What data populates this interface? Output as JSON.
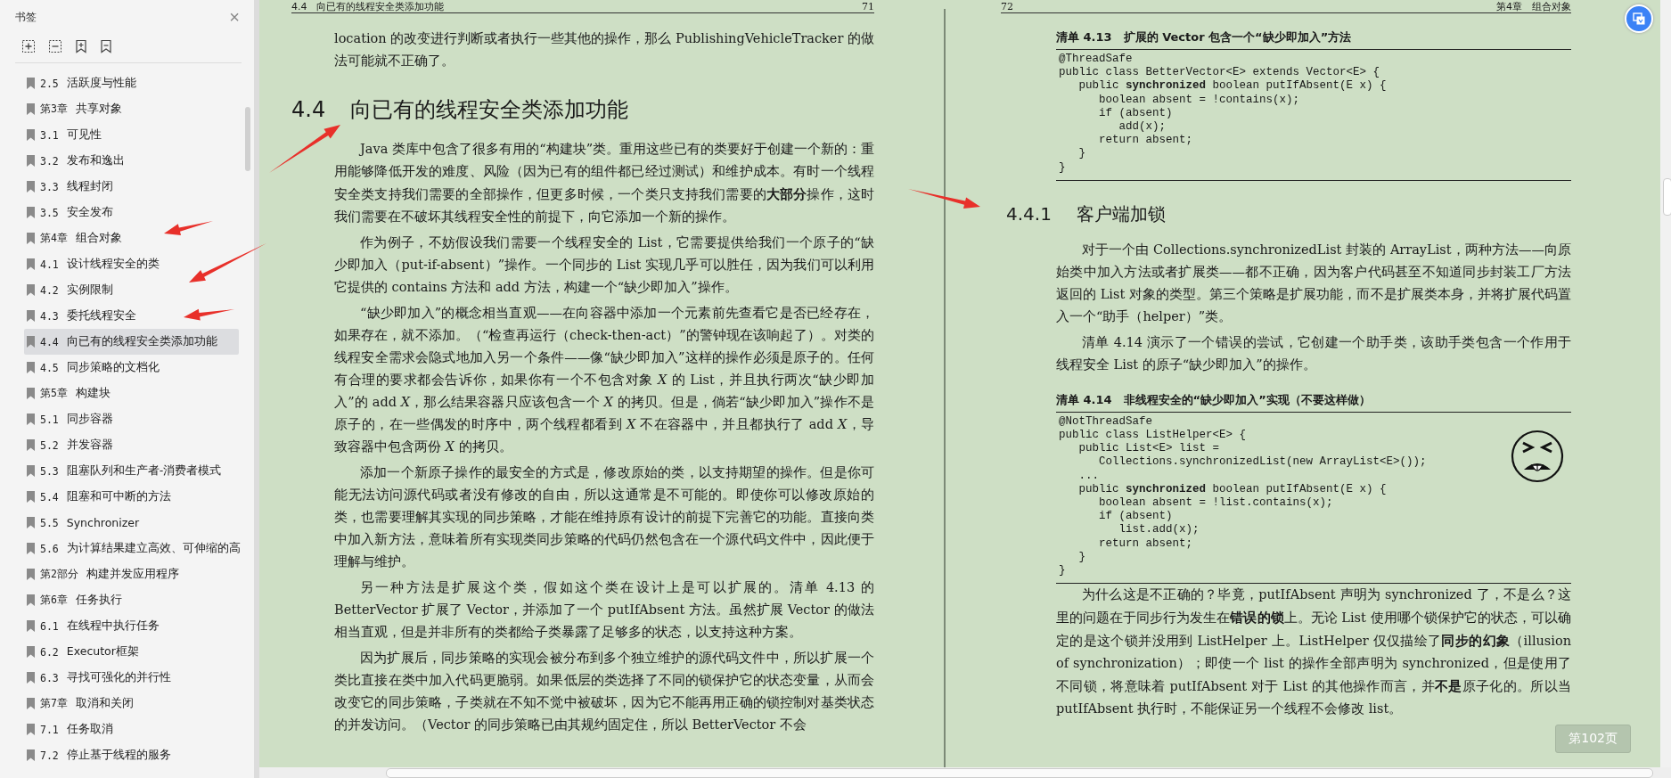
{
  "sidebar": {
    "title": "书签",
    "close": "×",
    "items": [
      {
        "num": "2.5",
        "title": "活跃度与性能",
        "selected": false
      },
      {
        "num": "第3章",
        "title": "共享对象",
        "selected": false
      },
      {
        "num": "3.1",
        "title": "可见性",
        "selected": false
      },
      {
        "num": "3.2",
        "title": "发布和逸出",
        "selected": false
      },
      {
        "num": "3.3",
        "title": "线程封闭",
        "selected": false
      },
      {
        "num": "3.5",
        "title": "安全发布",
        "selected": false
      },
      {
        "num": "第4章",
        "title": "组合对象",
        "selected": false
      },
      {
        "num": "4.1",
        "title": "设计线程安全的类",
        "selected": false
      },
      {
        "num": "4.2",
        "title": "实例限制",
        "selected": false
      },
      {
        "num": "4.3",
        "title": "委托线程安全",
        "selected": false
      },
      {
        "num": "4.4",
        "title": "向已有的线程安全类添加功能",
        "selected": true
      },
      {
        "num": "4.5",
        "title": "同步策略的文档化",
        "selected": false
      },
      {
        "num": "第5章",
        "title": "构建块",
        "selected": false
      },
      {
        "num": "5.1",
        "title": "同步容器",
        "selected": false
      },
      {
        "num": "5.2",
        "title": "并发容器",
        "selected": false
      },
      {
        "num": "5.3",
        "title": "阻塞队列和生产者-消费者模式",
        "selected": false
      },
      {
        "num": "5.4",
        "title": "阻塞和可中断的方法",
        "selected": false
      },
      {
        "num": "5.5",
        "title": "Synchronizer",
        "selected": false
      },
      {
        "num": "5.6",
        "title": "为计算结果建立高效、可伸缩的高",
        "selected": false
      },
      {
        "num": "第2部分",
        "title": "构建并发应用程序",
        "selected": false
      },
      {
        "num": "第6章",
        "title": "任务执行",
        "selected": false
      },
      {
        "num": "6.1",
        "title": "在线程中执行任务",
        "selected": false
      },
      {
        "num": "6.2",
        "title": "Executor框架",
        "selected": false
      },
      {
        "num": "6.3",
        "title": "寻找可强化的并行性",
        "selected": false
      },
      {
        "num": "第7章",
        "title": "取消和关闭",
        "selected": false
      },
      {
        "num": "7.1",
        "title": "任务取消",
        "selected": false
      },
      {
        "num": "7.2",
        "title": "停止基于线程的服务",
        "selected": false
      }
    ]
  },
  "left_page": {
    "header_title": "4.4　向已有的线程安全类添加功能",
    "page_number": "71",
    "blocks": [
      {
        "kind": "para",
        "text": "location 的改变进行判断或者执行一些其他的操作，那么 PublishingVehicleTracker 的做法可能就不正确了。",
        "indent": false
      },
      {
        "kind": "heading",
        "num": "4.4",
        "text": "向已有的线程安全类添加功能"
      },
      {
        "kind": "para",
        "text": "Java 类库中包含了很多有用的“构建块”类。重用这些已有的类要好于创建一个新的：重用能够降低开发的难度、风险（因为已有的组件都已经过测试）和维护成本。有时一个线程安全类支持我们需要的全部操作，但更多时候，一个类只支持我们需要的**大部分**操作，这时我们需要在不破坏其线程安全性的前提下，向它添加一个新的操作。",
        "indent": true
      },
      {
        "kind": "para",
        "text": "作为例子，不妨假设我们需要一个线程安全的 List，它需要提供给我们一个原子的“缺少即加入（put-if-absent）”操作。一个同步的 List 实现几乎可以胜任，因为我们可以利用它提供的 contains 方法和 add 方法，构建一个“缺少即加入”操作。",
        "indent": true
      },
      {
        "kind": "para",
        "text": "“缺少即加入”的概念相当直观——在向容器中添加一个元素前先查看它是否已经存在，如果存在，就不添加。（“检查再运行（check-then-act）”的警钟现在该响起了）。对类的线程安全需求会隐式地加入另一个条件——像“缺少即加入”这样的操作必须是原子的。任何有合理的要求都会告诉你，如果你有一个不包含对象 *X* 的 List，并且执行两次“缺少即加入”的 add *X*，那么结果容器只应该包含一个 *X* 的拷贝。但是，倘若“缺少即加入”操作不是原子的，在一些偶发的时序中，两个线程都看到 *X* 不在容器中，并且都执行了 add *X*，导致容器中包含两份 *X* 的拷贝。",
        "indent": true
      },
      {
        "kind": "para",
        "text": "添加一个新原子操作的最安全的方式是，修改原始的类，以支持期望的操作。但是你可能无法访问源代码或者没有修改的自由，所以这通常是不可能的。即使你可以修改原始的类，也需要理解其实现的同步策略，才能在维持原有设计的前提下完善它的功能。直接向类中加入新方法，意味着所有实现类同步策略的代码仍然包含在一个源代码文件中，因此便于理解与维护。",
        "indent": true
      },
      {
        "kind": "para",
        "text": "另一种方法是扩展这个类，假如这个类在设计上是可以扩展的。清单 4.13 的 BetterVector 扩展了 Vector，并添加了一个 putIfAbsent 方法。虽然扩展 Vector 的做法相当直观，但是并非所有的类都给子类暴露了足够多的状态，以支持这种方案。",
        "indent": true
      },
      {
        "kind": "para",
        "text": "因为扩展后，同步策略的实现会被分布到多个独立维护的源代码文件中，所以扩展一个类比直接在类中加入代码更脆弱。如果低层的类选择了不同的锁保护它的状态变量，从而会改变它的同步策略，子类就在不知不觉中被破坏，因为它不能再用正确的锁控制对基类状态的并发访问。（Vector 的同步策略已由其规约固定住，所以 BetterVector 不会",
        "indent": true
      }
    ]
  },
  "right_page": {
    "header_title": "第4章　组合对象",
    "page_number": "72",
    "blocks": [
      {
        "kind": "listing",
        "caption": "清单 4.13　扩展的 Vector 包含一个“缺少即加入”方法",
        "face": false,
        "lines": [
          "@ThreadSafe",
          "public class BetterVector<E> extends Vector<E> {",
          "   public **synchronized** boolean putIfAbsent(E x) {",
          "      boolean absent = !contains(x);",
          "      if (absent)",
          "         add(x);",
          "      return absent;",
          "   }",
          "}"
        ]
      },
      {
        "kind": "heading",
        "num": "4.4.1",
        "text": "客户端加锁"
      },
      {
        "kind": "para",
        "text": "对于一个由 Collections.synchronizedList 封装的 ArrayList，两种方法——向原始类中加入方法或者扩展类——都不正确，因为客户代码甚至不知道同步封装工厂方法返回的 List 对象的类型。第三个策略是扩展功能，而不是扩展类本身，并将扩展代码置入一个“助手（helper）”类。",
        "indent": true
      },
      {
        "kind": "para",
        "text": "清单 4.14 演示了一个错误的尝试，它创建一个助手类，该助手类包含一个作用于线程安全 List 的原子“缺少即加入”的操作。",
        "indent": true
      },
      {
        "kind": "listing",
        "caption": "清单 4.14　非线程安全的“缺少即加入”实现（不要这样做）",
        "face": true,
        "lines": [
          "@NotThreadSafe",
          "public class ListHelper<E> {",
          "   public List<E> list =",
          "      Collections.synchronizedList(new ArrayList<E>());",
          "   ...",
          "   public **synchronized** boolean putIfAbsent(E x) {",
          "      boolean absent = !list.contains(x);",
          "      if (absent)",
          "         list.add(x);",
          "      return absent;",
          "   }",
          "}"
        ]
      },
      {
        "kind": "para",
        "text": "为什么这是不正确的？毕竟，putIfAbsent 声明为 synchronized 了，不是么？这里的问题在于同步行为发生在**错误的锁**上。无论 List 使用哪个锁保护它的状态，可以确定的是这个锁并没用到 ListHelper 上。ListHelper 仅仅描绘了**同步的幻象**（illusion of synchronization）；即使一个 list 的操作全部声明为 synchronized，但是使用了不同锁，将意味着 putIfAbsent 对于 List 的其他操作而言，并**不是**原子化的。所以当 putIfAbsent 执行时，不能保证另一个线程不会修改 list。",
        "indent": true
      }
    ]
  },
  "page_indicator": "第102页"
}
